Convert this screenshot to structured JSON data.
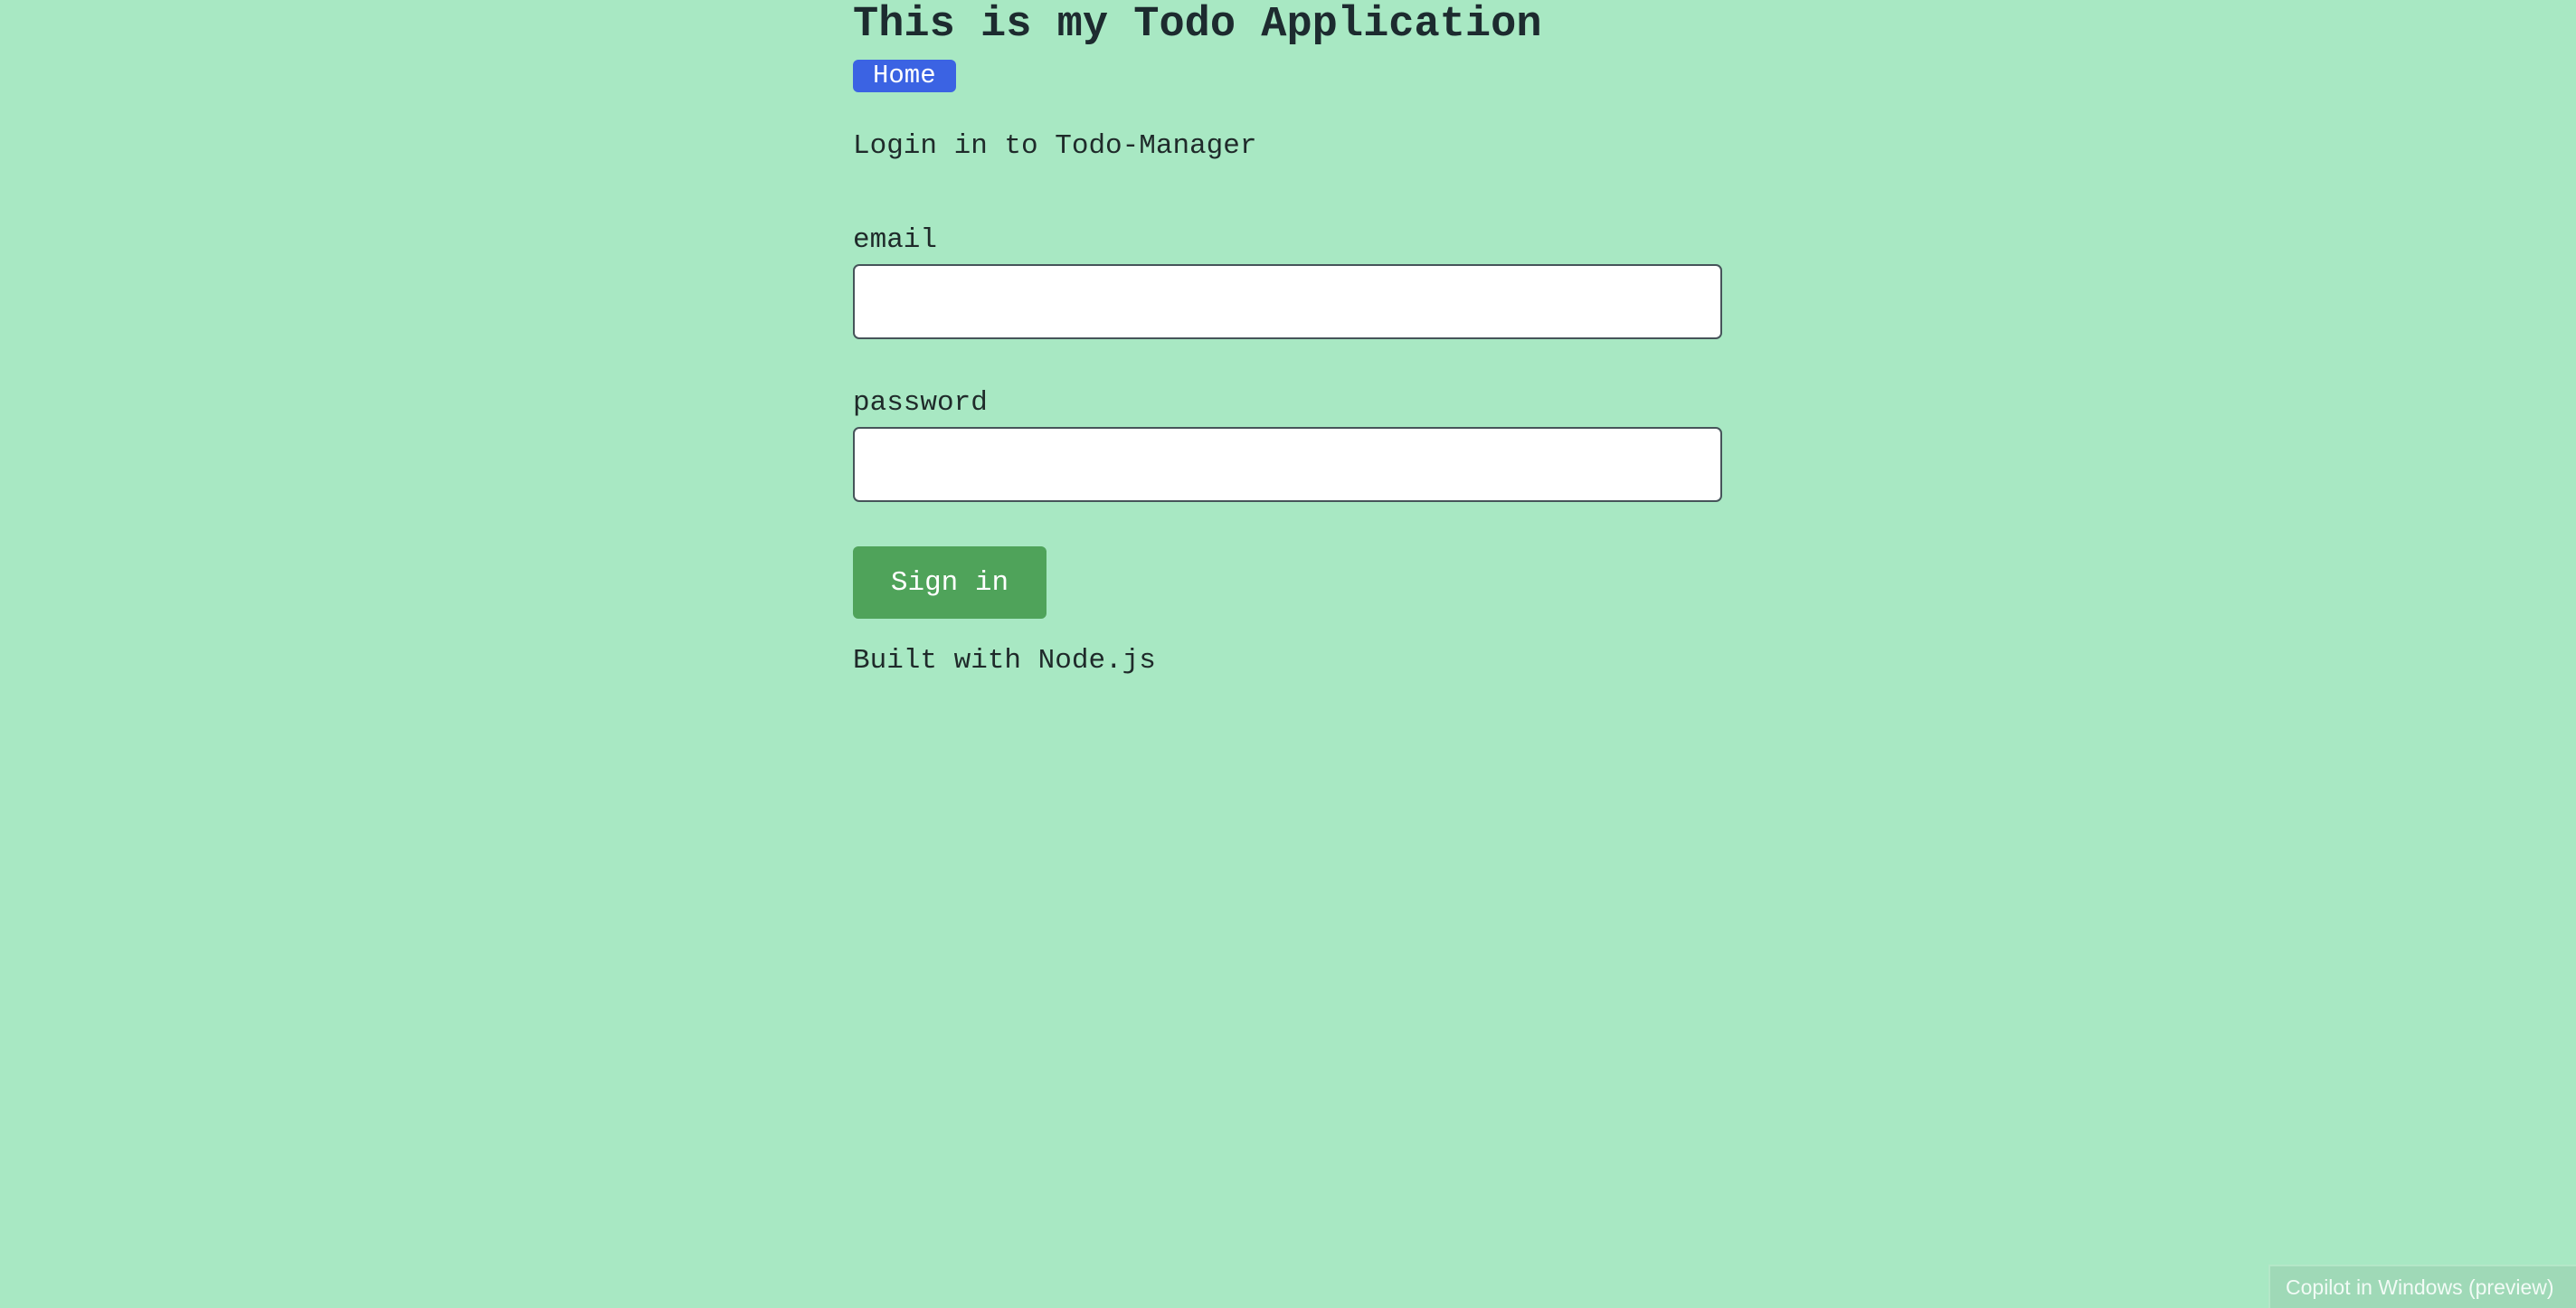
{
  "header": {
    "title": "This is my Todo Application",
    "home_label": "Home"
  },
  "login": {
    "heading": "Login in to Todo-Manager",
    "email_label": "email",
    "email_value": "",
    "password_label": "password",
    "password_value": "",
    "submit_label": "Sign in"
  },
  "footer": {
    "text": "Built with Node.js"
  },
  "system": {
    "copilot_label": "Copilot in Windows (preview)"
  },
  "colors": {
    "background": "#a8e8c3",
    "home_button": "#3b63e3",
    "signin_button": "#4fa35a",
    "text": "#1f2a2a"
  }
}
